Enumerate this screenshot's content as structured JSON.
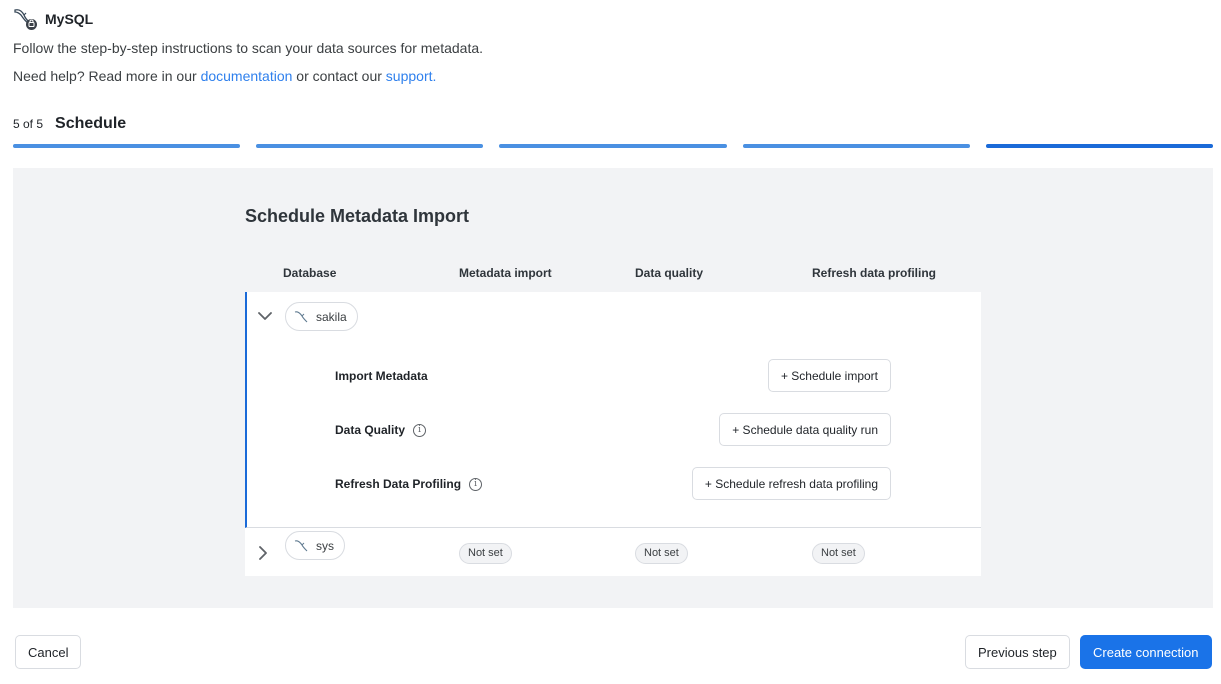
{
  "app": {
    "title": "MySQL",
    "logo_icon": "mysql-dolphin-icon",
    "subtitle": "Follow the step-by-step instructions to scan your data sources for metadata.",
    "help_prefix": "Need help? Read more in our ",
    "help_link_docs": "documentation",
    "help_middle": " or contact our ",
    "help_link_support": "support."
  },
  "stepper": {
    "count": "5 of 5",
    "current": "Schedule",
    "total_steps": 5,
    "current_step": 5
  },
  "panel": {
    "title": "Schedule Metadata Import",
    "columns": [
      "Database",
      "Metadata import",
      "Data quality",
      "Refresh data profiling"
    ],
    "databases": [
      {
        "name": "sakila",
        "expanded": true,
        "items": [
          {
            "label": "Import Metadata",
            "button": "+ Schedule import",
            "info": false
          },
          {
            "label": "Data Quality",
            "button": "+ Schedule data quality run",
            "info": true
          },
          {
            "label": "Refresh Data Profiling",
            "button": "+ Schedule refresh data profiling",
            "info": true
          }
        ]
      },
      {
        "name": "sys",
        "expanded": false,
        "metadata_import": "Not set",
        "data_quality": "Not set",
        "refresh_profiling": "Not set"
      }
    ]
  },
  "footer": {
    "cancel": "Cancel",
    "previous": "Previous step",
    "create": "Create connection"
  },
  "colors": {
    "accent": "#1a73e8",
    "link": "#2f80ed",
    "panel_bg": "#f2f3f5"
  }
}
